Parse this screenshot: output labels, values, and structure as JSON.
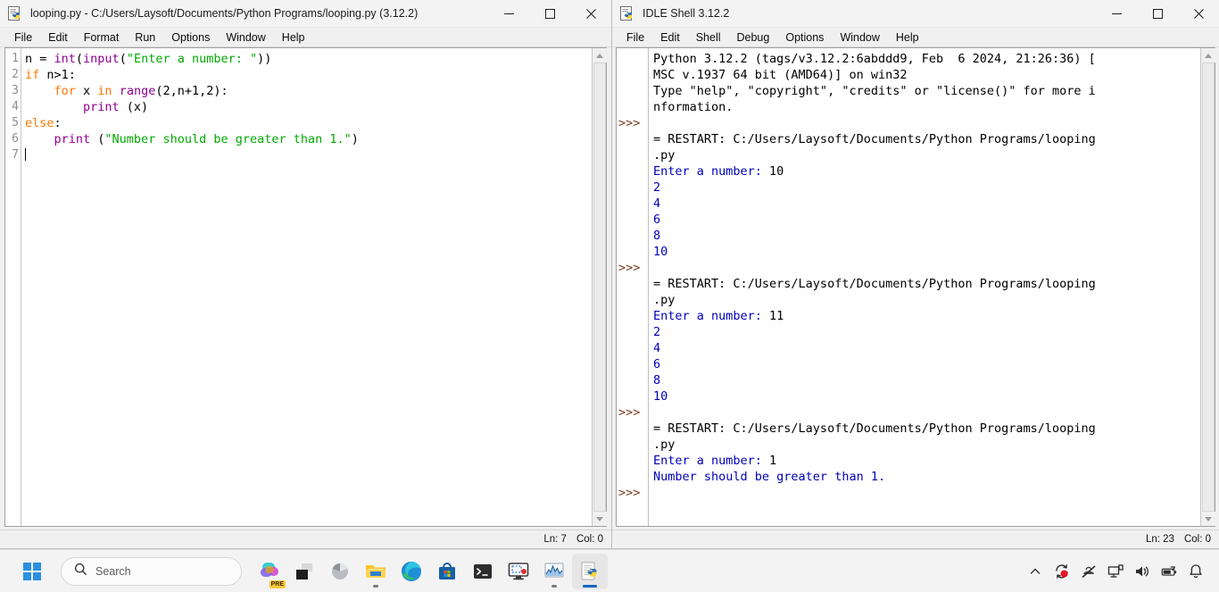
{
  "editor": {
    "title": "looping.py - C:/Users/Laysoft/Documents/Python Programs/looping.py (3.12.2)",
    "icon": "python-file-icon",
    "window_controls": {
      "minimize": "minimize-icon",
      "maximize": "maximize-icon",
      "close": "close-icon"
    },
    "menus": [
      "File",
      "Edit",
      "Format",
      "Run",
      "Options",
      "Window",
      "Help"
    ],
    "line_numbers": [
      "1",
      "2",
      "3",
      "4",
      "5",
      "6",
      "7"
    ],
    "code_lines": [
      "n = int(input(\"Enter a number: \"))",
      "if n>1:",
      "    for x in range(2,n+1,2):",
      "        print (x)",
      "else:",
      "    print (\"Number should be greater than 1.\")",
      ""
    ],
    "status": {
      "line": "Ln: 7",
      "col": "Col: 0"
    }
  },
  "shell": {
    "title": "IDLE Shell 3.12.2",
    "icon": "python-shell-icon",
    "window_controls": {
      "minimize": "minimize-icon",
      "maximize": "maximize-icon",
      "close": "close-icon"
    },
    "menus": [
      "File",
      "Edit",
      "Shell",
      "Debug",
      "Options",
      "Window",
      "Help"
    ],
    "prompt_symbol": ">>>",
    "output_lines": [
      {
        "text": "Python 3.12.2 (tags/v3.12.2:6abddd9, Feb  6 2024, 21:26:36) [",
        "color": "black",
        "prompt": false
      },
      {
        "text": "MSC v.1937 64 bit (AMD64)] on win32",
        "color": "black",
        "prompt": false
      },
      {
        "text": "Type \"help\", \"copyright\", \"credits\" or \"license()\" for more i",
        "color": "black",
        "prompt": false
      },
      {
        "text": "nformation.",
        "color": "black",
        "prompt": false
      },
      {
        "text": "",
        "color": "black",
        "prompt": true
      },
      {
        "text": "= RESTART: C:/Users/Laysoft/Documents/Python Programs/looping",
        "color": "black",
        "prompt": false
      },
      {
        "text": ".py",
        "color": "black",
        "prompt": false
      },
      {
        "text": "Enter a number: 10",
        "color": "mixed",
        "prompt": false,
        "blue_part": "Enter a number: ",
        "black_part": "10"
      },
      {
        "text": "2",
        "color": "blue",
        "prompt": false
      },
      {
        "text": "4",
        "color": "blue",
        "prompt": false
      },
      {
        "text": "6",
        "color": "blue",
        "prompt": false
      },
      {
        "text": "8",
        "color": "blue",
        "prompt": false
      },
      {
        "text": "10",
        "color": "blue",
        "prompt": false
      },
      {
        "text": "",
        "color": "black",
        "prompt": true
      },
      {
        "text": "= RESTART: C:/Users/Laysoft/Documents/Python Programs/looping",
        "color": "black",
        "prompt": false
      },
      {
        "text": ".py",
        "color": "black",
        "prompt": false
      },
      {
        "text": "Enter a number: 11",
        "color": "mixed",
        "prompt": false,
        "blue_part": "Enter a number: ",
        "black_part": "11"
      },
      {
        "text": "2",
        "color": "blue",
        "prompt": false
      },
      {
        "text": "4",
        "color": "blue",
        "prompt": false
      },
      {
        "text": "6",
        "color": "blue",
        "prompt": false
      },
      {
        "text": "8",
        "color": "blue",
        "prompt": false
      },
      {
        "text": "10",
        "color": "blue",
        "prompt": false
      },
      {
        "text": "",
        "color": "black",
        "prompt": true
      },
      {
        "text": "= RESTART: C:/Users/Laysoft/Documents/Python Programs/looping",
        "color": "black",
        "prompt": false
      },
      {
        "text": ".py",
        "color": "black",
        "prompt": false
      },
      {
        "text": "Enter a number: 1",
        "color": "mixed",
        "prompt": false,
        "blue_part": "Enter a number: ",
        "black_part": "1"
      },
      {
        "text": "Number should be greater than 1.",
        "color": "blue",
        "prompt": false
      },
      {
        "text": "",
        "color": "black",
        "prompt": true
      }
    ],
    "status": {
      "line": "Ln: 23",
      "col": "Col: 0"
    }
  },
  "taskbar": {
    "start": "windows-start-icon",
    "search": {
      "placeholder": "Search",
      "icon": "search-icon"
    },
    "items": [
      {
        "name": "copilot-icon",
        "badge": "PRE"
      },
      {
        "name": "task-view-icon",
        "badge": ""
      },
      {
        "name": "widgets-icon",
        "badge": ""
      },
      {
        "name": "file-explorer-icon",
        "badge": ""
      },
      {
        "name": "microsoft-edge-icon",
        "badge": ""
      },
      {
        "name": "microsoft-store-icon",
        "badge": ""
      },
      {
        "name": "terminal-icon",
        "badge": ""
      },
      {
        "name": "screen-recorder-icon",
        "badge": ""
      },
      {
        "name": "performance-monitor-icon",
        "badge": ""
      },
      {
        "name": "python-idle-icon",
        "badge": ""
      }
    ],
    "tray": [
      "show-hidden-icons-chevron",
      "recording-indicator-icon",
      "mute-icon",
      "cast-display-icon",
      "volume-icon",
      "battery-icon",
      "notifications-bell-icon"
    ]
  },
  "colors": {
    "keyword": "#ff7700",
    "builtin": "#900090",
    "string": "#00aa00",
    "stdout": "#0000bb",
    "prompt": "#7a3b1e",
    "accent": "#0a66c2"
  }
}
